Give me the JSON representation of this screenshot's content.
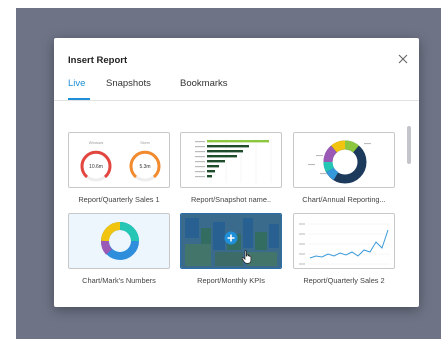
{
  "dialog": {
    "title": "Insert Report",
    "tabs": [
      {
        "label": "Live",
        "active": true
      },
      {
        "label": "Snapshots",
        "active": false
      },
      {
        "label": "Bookmarks",
        "active": false
      }
    ]
  },
  "reports": [
    {
      "label": "Report/Quarterly Sales 1",
      "gauge_left_title": "Windows",
      "gauge_left_value": "10.6m",
      "gauge_right_title": "Storm",
      "gauge_right_value": "5.3m"
    },
    {
      "label": "Report/Snapshot name.."
    },
    {
      "label": "Chart/Annual Reporting..."
    },
    {
      "label": "Chart/Mark's Numbers"
    },
    {
      "label": "Report/Monthly KPIs",
      "hovered": true
    },
    {
      "label": "Report/Quarterly Sales 2"
    }
  ],
  "colors": {
    "accent": "#1e8fd8",
    "backdrop": "#6e7486",
    "hover_overlay": "#1e6ea8"
  },
  "icons": [
    "close-icon",
    "plus-icon",
    "hand-cursor-icon"
  ]
}
